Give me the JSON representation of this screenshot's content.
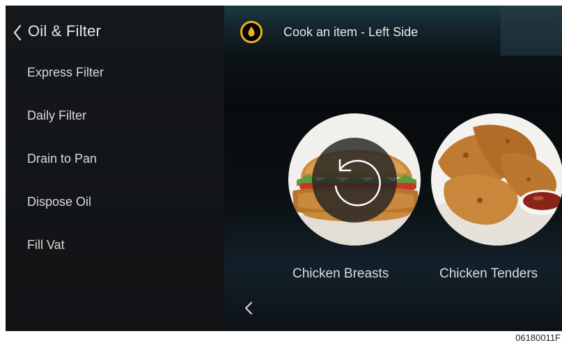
{
  "sidebar": {
    "title": "Oil & Filter",
    "items": [
      {
        "label": "Express Filter"
      },
      {
        "label": "Daily Filter"
      },
      {
        "label": "Drain to Pan"
      },
      {
        "label": "Dispose Oil"
      },
      {
        "label": "Fill Vat"
      }
    ]
  },
  "main": {
    "title": "Cook an item - Left Side",
    "oil_icon": "oil-drop-icon",
    "accent_color": "#f2b020",
    "products": [
      {
        "label": "Chicken Breasts",
        "image": "chicken-sandwich-image"
      },
      {
        "label": "Chicken Tenders",
        "image": "chicken-tenders-image"
      }
    ],
    "reset_icon": "reset-icon",
    "prev_icon": "chevron-left-icon"
  },
  "footer": {
    "figure_code": "06180011F"
  }
}
